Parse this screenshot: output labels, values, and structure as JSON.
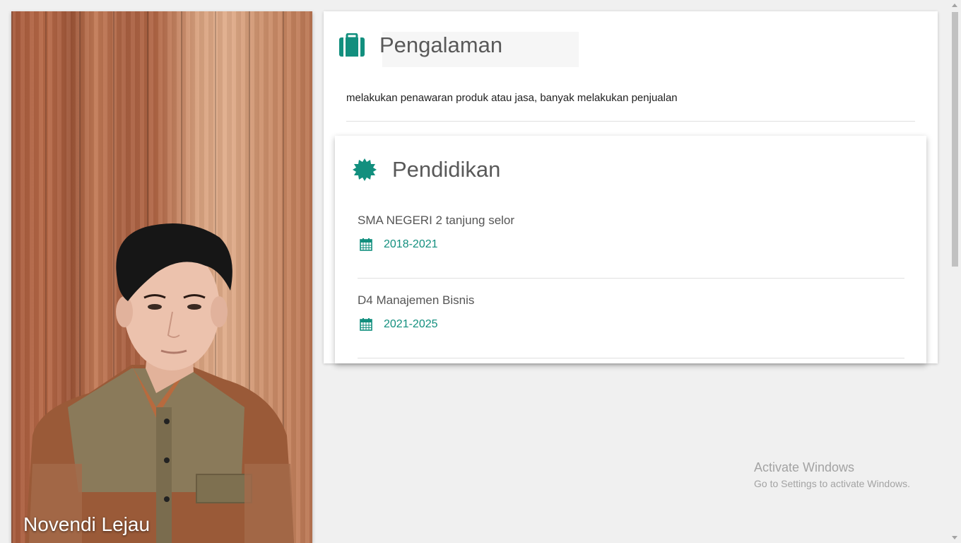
{
  "profile": {
    "name": "Novendi Lejau"
  },
  "experience": {
    "title": "Pengalaman",
    "icon": "briefcase-icon",
    "description": "melakukan penawaran produk atau jasa, banyak melakukan penjualan"
  },
  "education": {
    "title": "Pendidikan",
    "icon": "badge-icon",
    "items": [
      {
        "school": "SMA NEGERI 2 tanjung selor",
        "years": "2018-2021",
        "icon": "calendar-icon"
      },
      {
        "school": "D4 Manajemen Bisnis",
        "years": "2021-2025",
        "icon": "calendar-icon"
      }
    ]
  },
  "watermark": {
    "title": "Activate Windows",
    "subtitle": "Go to Settings to activate Windows."
  },
  "colors": {
    "accent": "#128f7e",
    "background": "#f0f0f0",
    "card": "#ffffff"
  }
}
